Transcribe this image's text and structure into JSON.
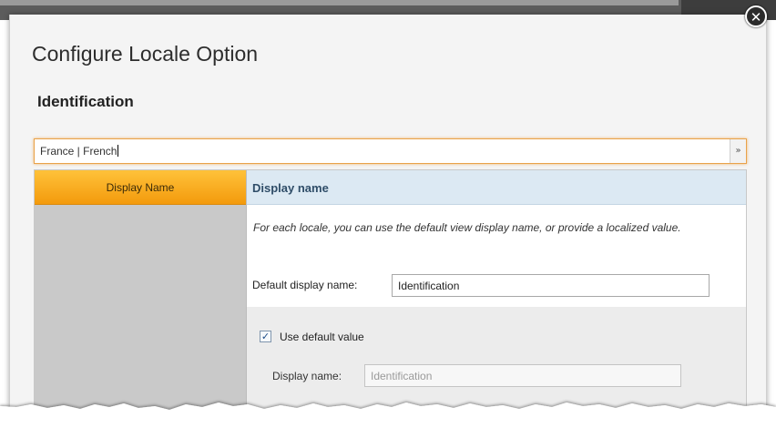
{
  "dialog": {
    "title": "Configure Locale Option",
    "close_icon": "close-icon",
    "section_title": "Identification"
  },
  "locale_select": {
    "value": "France | French",
    "arrow_icon": "double-chevron-down-icon"
  },
  "left_nav": {
    "items": [
      {
        "label": "Display Name",
        "active": true
      }
    ]
  },
  "pane": {
    "header": "Display name",
    "description": "For each locale, you can use the default view display name, or provide a localized value.",
    "default_display_name_label": "Default display name:",
    "default_display_name_value": "Identification",
    "use_default_checkbox": {
      "label": "Use default value",
      "checked": true
    },
    "display_name_label": "Display name:",
    "display_name_value": "Identification"
  },
  "colors": {
    "accent_orange": "#f39a0c",
    "focus_border": "#e9a24a",
    "header_blue": "#dce9f3",
    "nav_gray": "#c9c9c9"
  }
}
